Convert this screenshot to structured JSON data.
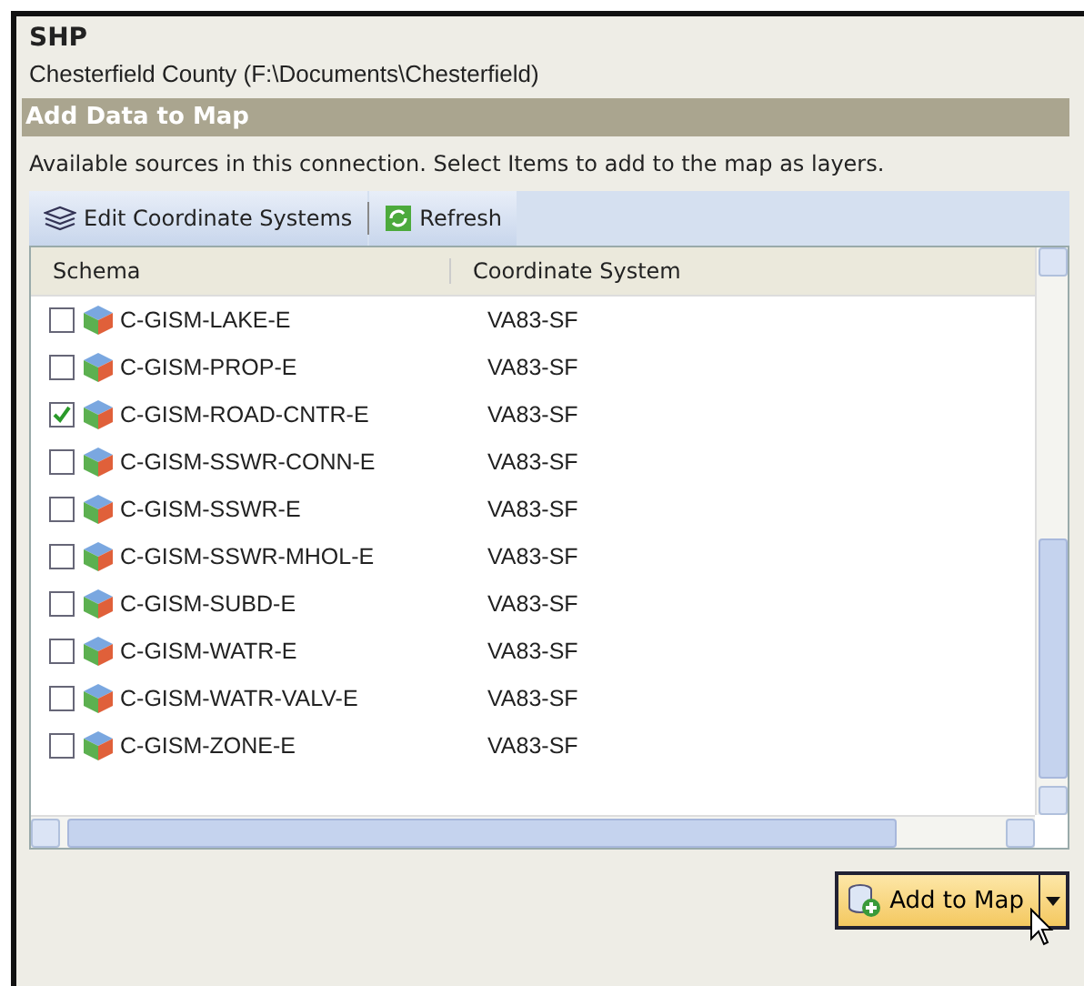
{
  "title": "SHP",
  "subtitle": "Chesterfield County (F:\\Documents\\Chesterfield)",
  "section_header": "Add Data to Map",
  "description": "Available sources in this connection.  Select Items to add to the map as layers.",
  "toolbar": [
    {
      "kind": "layers",
      "label": "Edit Coordinate Systems"
    },
    {
      "kind": "refresh",
      "label": "Refresh"
    }
  ],
  "table": {
    "columns": [
      "Schema",
      "Coordinate System"
    ],
    "rows": [
      {
        "schema": "C-GISM-LAKE-E",
        "coordinate_system": "VA83-SF",
        "checked": false
      },
      {
        "schema": "C-GISM-PROP-E",
        "coordinate_system": "VA83-SF",
        "checked": false
      },
      {
        "schema": "C-GISM-ROAD-CNTR-E",
        "coordinate_system": "VA83-SF",
        "checked": true
      },
      {
        "schema": "C-GISM-SSWR-CONN-E",
        "coordinate_system": "VA83-SF",
        "checked": false
      },
      {
        "schema": "C-GISM-SSWR-E",
        "coordinate_system": "VA83-SF",
        "checked": false
      },
      {
        "schema": "C-GISM-SSWR-MHOL-E",
        "coordinate_system": "VA83-SF",
        "checked": false
      },
      {
        "schema": "C-GISM-SUBD-E",
        "coordinate_system": "VA83-SF",
        "checked": false
      },
      {
        "schema": "C-GISM-WATR-E",
        "coordinate_system": "VA83-SF",
        "checked": false
      },
      {
        "schema": "C-GISM-WATR-VALV-E",
        "coordinate_system": "VA83-SF",
        "checked": false
      },
      {
        "schema": "C-GISM-ZONE-E",
        "coordinate_system": "VA83-SF",
        "checked": false
      }
    ]
  },
  "add_button": {
    "label": "Add to Map"
  }
}
